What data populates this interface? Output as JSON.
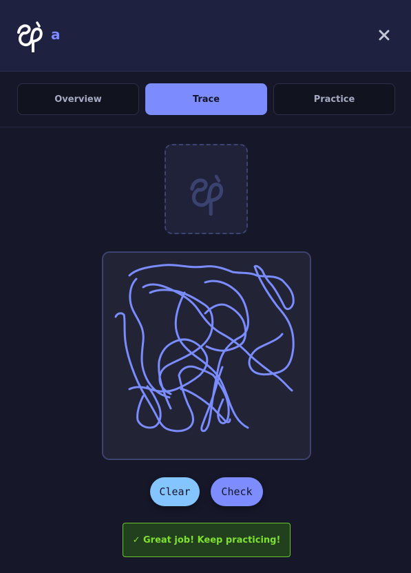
{
  "header": {
    "glyph": "ඇ",
    "romanization": "a",
    "close_icon": "close-icon"
  },
  "tabs": [
    {
      "label": "Overview",
      "active": false
    },
    {
      "label": "Trace",
      "active": true
    },
    {
      "label": "Practice",
      "active": false
    }
  ],
  "reference": {
    "glyph": "ඇ"
  },
  "buttons": {
    "clear_label": "Clear",
    "check_label": "Check"
  },
  "feedback": {
    "text": "✓ Great job! Keep practicing!"
  },
  "colors": {
    "accent": "#7c8cff",
    "stroke": "#7b8cff",
    "success": "#7ee02f",
    "clear_button": "#84c4ff",
    "background": "#161829"
  }
}
